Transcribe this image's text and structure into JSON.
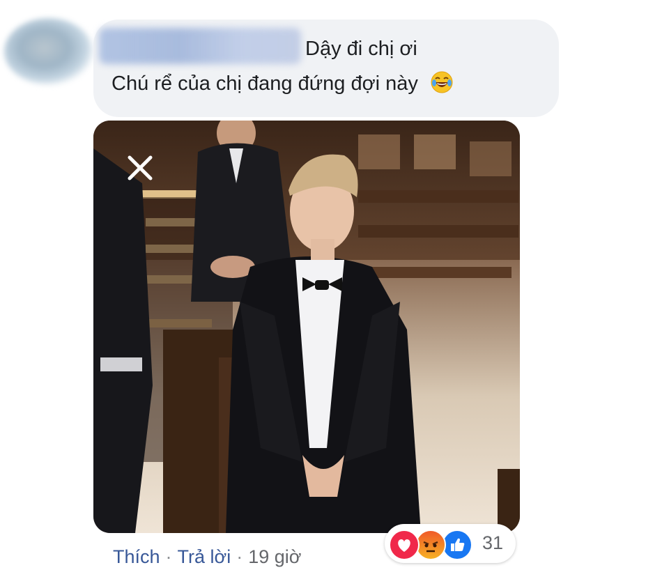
{
  "comment": {
    "author_name": "",
    "line1": "Dậy đi chị ơi",
    "line2": "Chú rể của chị đang đứng đợi này",
    "emoji": "face-with-tears-of-joy"
  },
  "photo": {
    "close_icon": "close-icon"
  },
  "actions": {
    "like_label": "Thích",
    "separator": "·",
    "reply_label": "Trả lời",
    "time": "19 giờ"
  },
  "reactions": {
    "icons": [
      "love-reaction-icon",
      "angry-reaction-icon",
      "like-reaction-icon"
    ],
    "count": "31"
  },
  "colors": {
    "bubble_bg": "#f0f2f5",
    "link": "#385898",
    "meta": "#65676b"
  }
}
